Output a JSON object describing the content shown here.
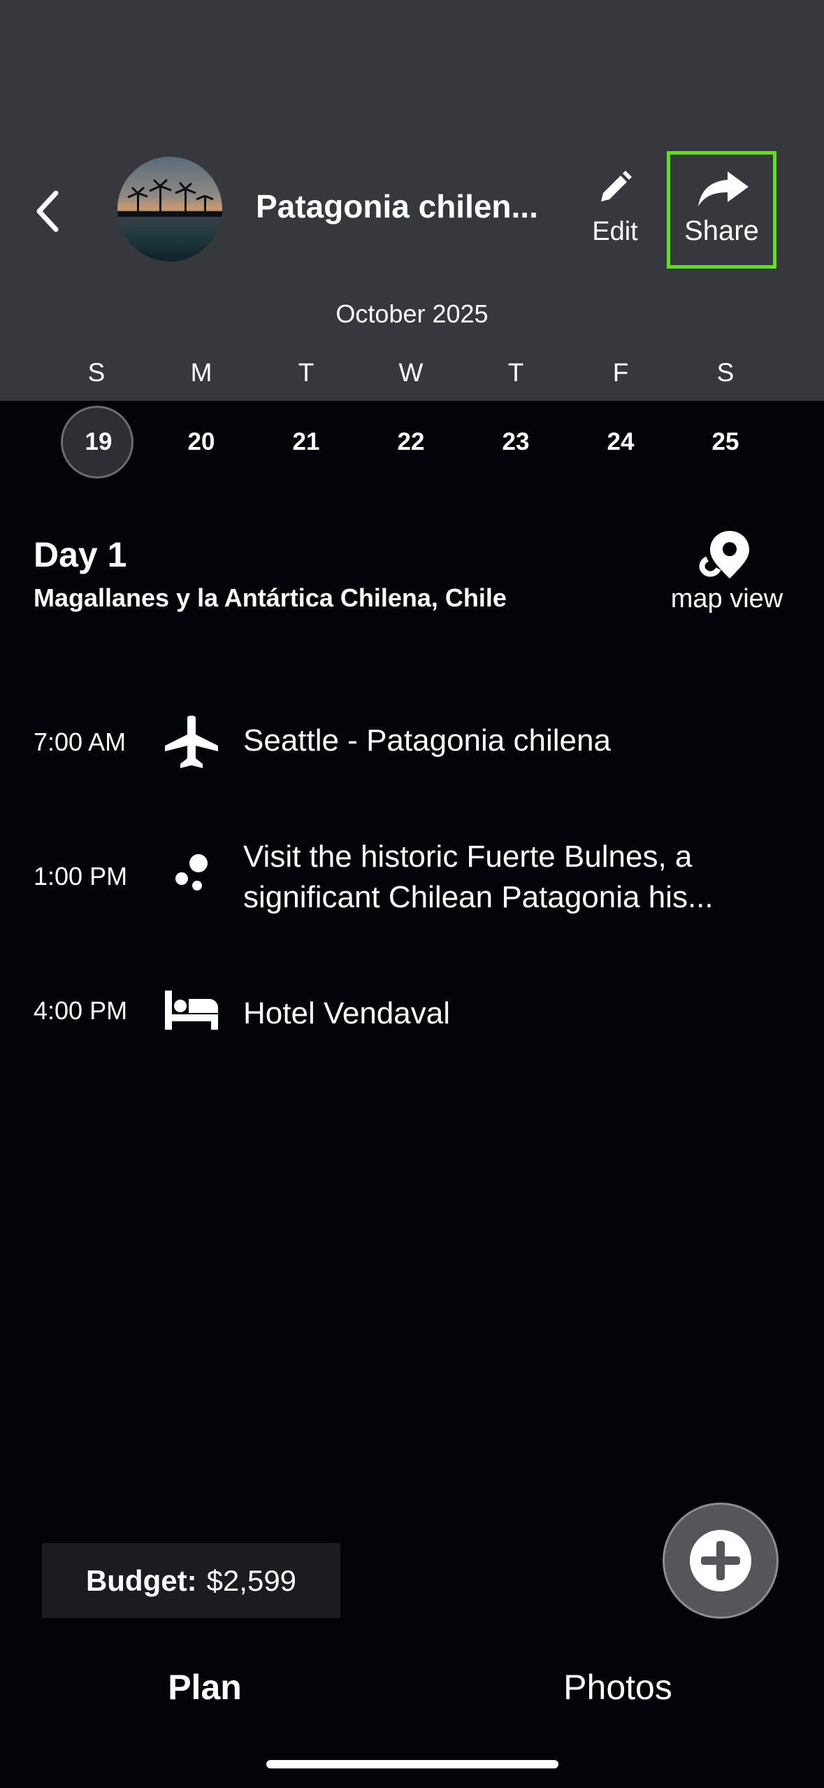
{
  "header": {
    "trip_title": "Patagonia chilen...",
    "edit_label": "Edit",
    "share_label": "Share",
    "back_icon": "chevron-left-icon",
    "edit_icon": "pencil-icon",
    "share_icon": "share-arrow-icon",
    "highlight_color": "#5de21a"
  },
  "calendar": {
    "month": "October 2025",
    "weekdays": [
      "S",
      "M",
      "T",
      "W",
      "T",
      "F",
      "S"
    ],
    "dates": [
      "19",
      "20",
      "21",
      "22",
      "23",
      "24",
      "25"
    ],
    "selected_index": 0
  },
  "day": {
    "title": "Day 1",
    "location": "Magallanes y la Antártica Chilena, Chile",
    "map_view_label": "map view",
    "map_icon": "map-pin-icon"
  },
  "events": [
    {
      "time": "7:00 AM",
      "icon": "airplane-icon",
      "text": "Seattle - Patagonia chilena"
    },
    {
      "time": "1:00 PM",
      "icon": "activity-dots-icon",
      "text": "Visit the historic Fuerte Bulnes, a significant Chilean Patagonia his..."
    },
    {
      "time": "4:00 PM",
      "icon": "bed-icon",
      "text": "Hotel Vendaval"
    }
  ],
  "budget": {
    "label": "Budget:",
    "value": "$2,599"
  },
  "fab_icon": "plus-circle-icon",
  "tabs": [
    {
      "label": "Plan",
      "active": true
    },
    {
      "label": "Photos",
      "active": false
    }
  ]
}
